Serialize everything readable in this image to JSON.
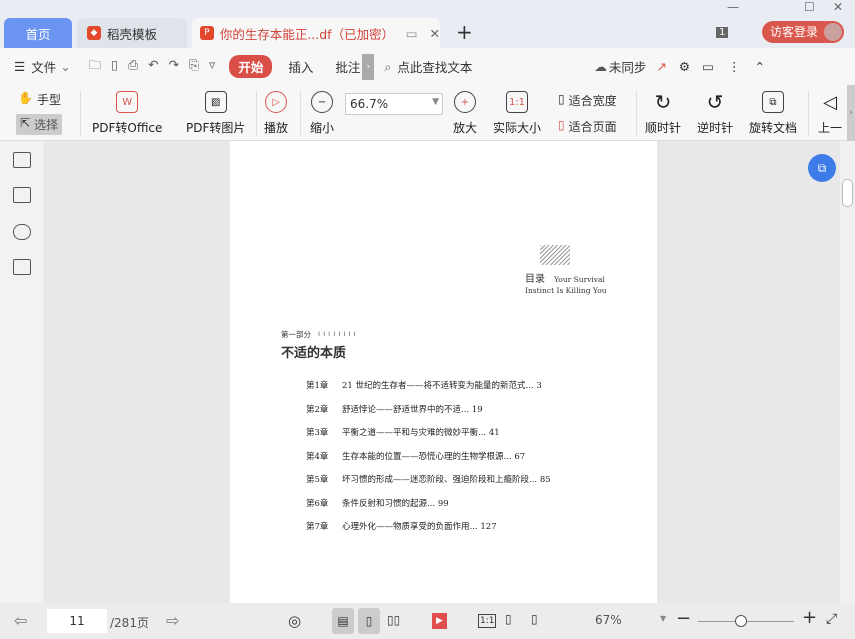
{
  "tabs": [
    {
      "label": "首页"
    },
    {
      "label": "稻壳模板"
    },
    {
      "label": "你的生存本能正...df（已加密）"
    }
  ],
  "window": {
    "page_count_badge": "1",
    "login": "访客登录"
  },
  "menu": {
    "file": "文件",
    "start": "开始",
    "insert": "插入",
    "annotate": "批注",
    "search_placeholder": "点此查找文本",
    "sync": "未同步"
  },
  "tools": {
    "hand": "手型",
    "select": "选择",
    "pdf_to_office": "PDF转Office",
    "pdf_to_image": "PDF转图片",
    "play": "播放",
    "zoom_out": "缩小",
    "zoom_value": "66.7%",
    "zoom_in": "放大",
    "actual_size": "实际大小",
    "actual_icon": "1:1",
    "fit_width": "适合宽度",
    "fit_page": "适合页面",
    "clockwise": "顺时针",
    "counterclockwise": "逆时针",
    "rotate_doc": "旋转文档",
    "prev": "上一"
  },
  "doc": {
    "toc_title": "目录",
    "subtitle1": "Your Survival",
    "subtitle2": "Instinct Is Killing You",
    "part": "第一部分",
    "part_title": "不适的本质",
    "chapters": [
      {
        "num": "第1章",
        "title": "21 世纪的生存者——将不适转变为能量的新范式...",
        "page": "3"
      },
      {
        "num": "第2章",
        "title": "舒适悖论——舒适世界中的不适...",
        "page": "19"
      },
      {
        "num": "第3章",
        "title": "平衡之道——平和与灾难的微妙平衡...",
        "page": "41"
      },
      {
        "num": "第4章",
        "title": "生存本能的位置——恐慌心理的生物学根源...",
        "page": "67"
      },
      {
        "num": "第5章",
        "title": "坏习惯的形成——迷恋阶段、强迫阶段和上瘾阶段...",
        "page": "85"
      },
      {
        "num": "第6章",
        "title": "条件反射和习惯的起源...",
        "page": "99"
      },
      {
        "num": "第7章",
        "title": "心理外化——物质享受的负面作用...",
        "page": "127"
      }
    ]
  },
  "status": {
    "current_page": "11",
    "total_pages": "/281页",
    "zoom": "67%",
    "zoom_fraction": 0.45,
    "actual_icon": "1:1"
  }
}
